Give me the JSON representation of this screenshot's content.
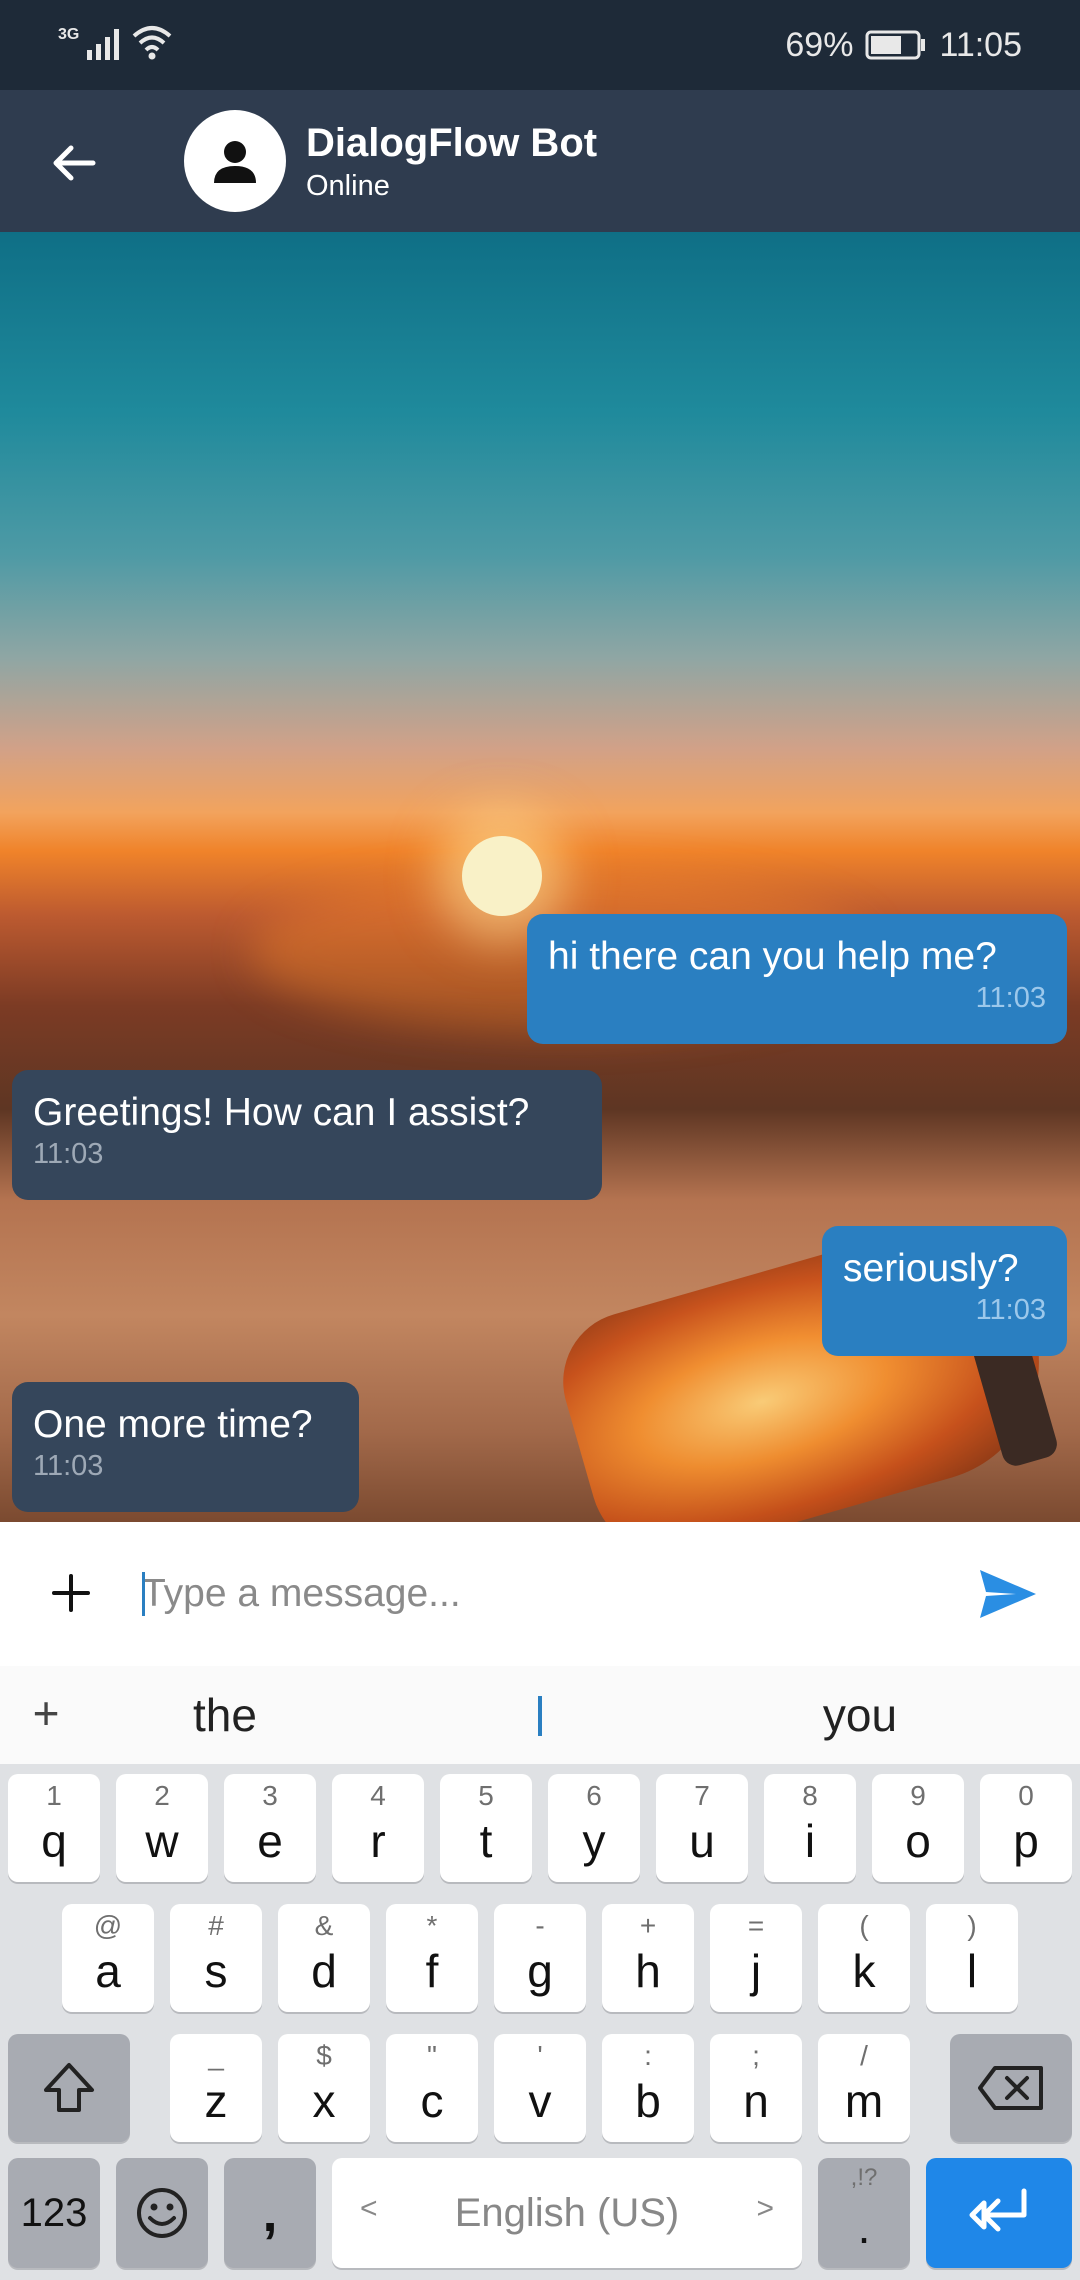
{
  "status_bar": {
    "network": "3G",
    "battery": "69%",
    "time": "11:05"
  },
  "header": {
    "name": "DialogFlow Bot",
    "status": "Online"
  },
  "messages": [
    {
      "dir": "out",
      "text": "hi there can you help me?",
      "time": "11:03"
    },
    {
      "dir": "in",
      "text": "Greetings! How can I assist?",
      "time": "11:03"
    },
    {
      "dir": "out",
      "text": "seriously?",
      "time": "11:03"
    },
    {
      "dir": "in",
      "text": "One more time?",
      "time": "11:03"
    }
  ],
  "composer": {
    "placeholder": "Type a message..."
  },
  "suggestions": {
    "left": "the",
    "middle": "I",
    "right": "you"
  },
  "keyboard": {
    "row1": [
      [
        "1",
        "q"
      ],
      [
        "2",
        "w"
      ],
      [
        "3",
        "e"
      ],
      [
        "4",
        "r"
      ],
      [
        "5",
        "t"
      ],
      [
        "6",
        "y"
      ],
      [
        "7",
        "u"
      ],
      [
        "8",
        "i"
      ],
      [
        "9",
        "o"
      ],
      [
        "0",
        "p"
      ]
    ],
    "row2": [
      [
        "@",
        "a"
      ],
      [
        "#",
        "s"
      ],
      [
        "&",
        "d"
      ],
      [
        "*",
        "f"
      ],
      [
        "-",
        "g"
      ],
      [
        "+",
        "h"
      ],
      [
        "=",
        "j"
      ],
      [
        "(",
        "k"
      ],
      [
        ")",
        "l"
      ]
    ],
    "row3": [
      [
        "_",
        "z"
      ],
      [
        "$",
        "x"
      ],
      [
        "\"",
        "c"
      ],
      [
        "'",
        "v"
      ],
      [
        ":",
        "b"
      ],
      [
        ";",
        "n"
      ],
      [
        "/",
        "m"
      ]
    ],
    "numbers_label": "123",
    "comma_label": ",",
    "space_label": "English (US)",
    "space_left": "<",
    "space_right": ">",
    "period_hint": ",!?",
    "period_label": "."
  },
  "colors": {
    "accent": "#2a7fc1",
    "header": "#2f3c4f",
    "incoming": "#35465b",
    "outgoing": "#2a7fc1",
    "enter": "#1f87e8"
  }
}
